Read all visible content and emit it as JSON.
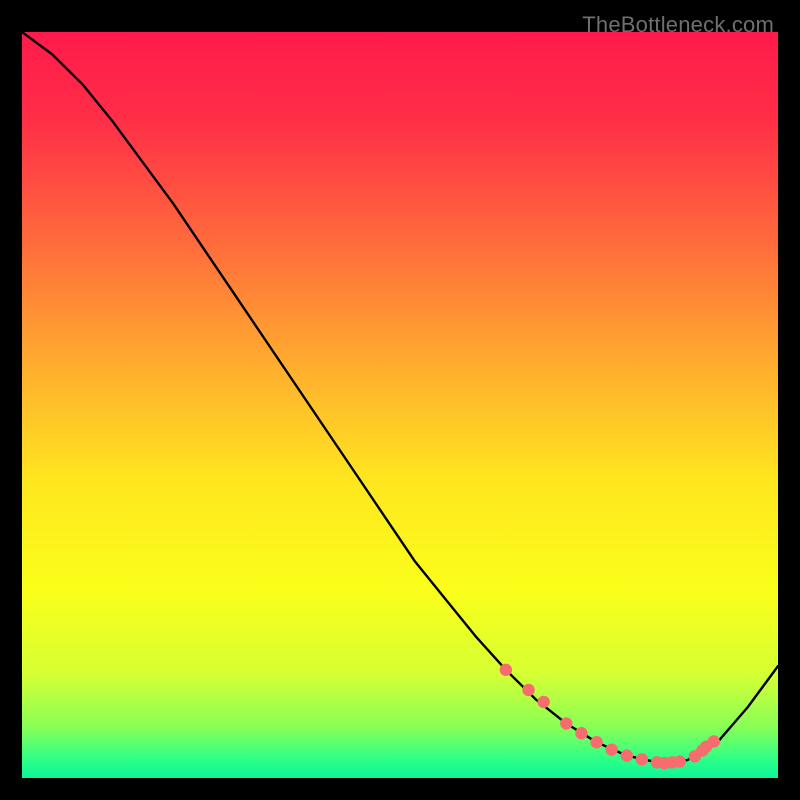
{
  "watermark": "TheBottleneck.com",
  "chart_data": {
    "type": "line",
    "title": "",
    "xlabel": "",
    "ylabel": "",
    "xlim": [
      0,
      100
    ],
    "ylim": [
      0,
      100
    ],
    "grid": false,
    "series": [
      {
        "name": "curve",
        "x": [
          0,
          4,
          8,
          12,
          16,
          20,
          24,
          28,
          32,
          36,
          40,
          44,
          48,
          52,
          56,
          60,
          64,
          68,
          72,
          76,
          80,
          84,
          88,
          92,
          96,
          100
        ],
        "y": [
          100,
          97,
          93,
          88,
          82.5,
          77,
          71,
          65,
          59,
          53,
          47,
          41,
          35,
          29,
          24,
          19,
          14.5,
          10.5,
          7.3,
          4.8,
          3.0,
          2.1,
          2.4,
          4.8,
          9.5,
          15
        ]
      }
    ],
    "markers": {
      "name": "points",
      "x": [
        64,
        67,
        69,
        72,
        74,
        76,
        78,
        80,
        82,
        84,
        85,
        86,
        87,
        89,
        90,
        90.5,
        91.5
      ],
      "y": [
        14.5,
        11.8,
        10.2,
        7.3,
        6.0,
        4.8,
        3.8,
        3.0,
        2.5,
        2.1,
        2.0,
        2.1,
        2.2,
        2.9,
        3.7,
        4.2,
        4.9
      ]
    },
    "gradient_stops": [
      {
        "offset": 0.0,
        "color": "#ff1a4b"
      },
      {
        "offset": 0.12,
        "color": "#ff2f47"
      },
      {
        "offset": 0.28,
        "color": "#ff6a3c"
      },
      {
        "offset": 0.45,
        "color": "#ffae2e"
      },
      {
        "offset": 0.6,
        "color": "#ffe61f"
      },
      {
        "offset": 0.75,
        "color": "#faff1a"
      },
      {
        "offset": 0.86,
        "color": "#d6ff33"
      },
      {
        "offset": 0.93,
        "color": "#8bff55"
      },
      {
        "offset": 0.975,
        "color": "#2dff86"
      },
      {
        "offset": 1.0,
        "color": "#0cf59a"
      }
    ],
    "marker_color": "#f76d6d",
    "curve_color": "#000000"
  }
}
